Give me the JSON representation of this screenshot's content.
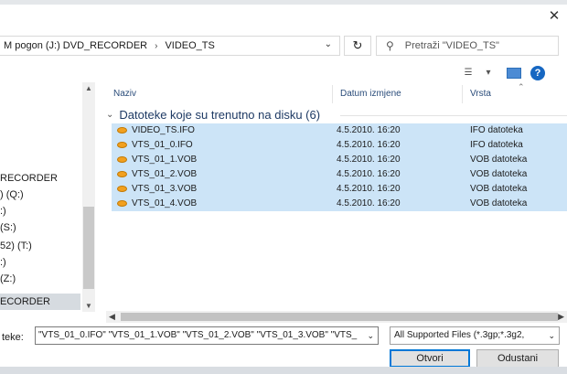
{
  "window": {
    "close_glyph": "✕"
  },
  "address": {
    "drive": "M pogon (J:) DVD_RECORDER",
    "separator": "›",
    "folder": "VIDEO_TS",
    "dropdown_icon": "chevron-down-icon"
  },
  "search": {
    "placeholder": "Pretraži \"VIDEO_TS\""
  },
  "nav": {
    "items": [
      {
        "label": "RECORDER",
        "selected": false
      },
      {
        "label": ") (Q:)",
        "selected": false
      },
      {
        "label": ":)",
        "selected": false
      },
      {
        "label": "(S:)",
        "selected": false
      },
      {
        "label": "52) (T:)",
        "selected": false
      },
      {
        "label": ":)",
        "selected": false
      },
      {
        "label": "(Z:)",
        "selected": false
      },
      {
        "label": "ECORDER",
        "selected": true
      }
    ]
  },
  "columns": {
    "name": "Naziv",
    "date": "Datum izmjene",
    "type": "Vrsta"
  },
  "group": {
    "label": "Datoteke koje su trenutno na disku (6)"
  },
  "files": [
    {
      "name": "VIDEO_TS.IFO",
      "date": "4.5.2010. 16:20",
      "type": "IFO datoteka"
    },
    {
      "name": "VTS_01_0.IFO",
      "date": "4.5.2010. 16:20",
      "type": "IFO datoteka"
    },
    {
      "name": "VTS_01_1.VOB",
      "date": "4.5.2010. 16:20",
      "type": "VOB datoteka"
    },
    {
      "name": "VTS_01_2.VOB",
      "date": "4.5.2010. 16:20",
      "type": "VOB datoteka"
    },
    {
      "name": "VTS_01_3.VOB",
      "date": "4.5.2010. 16:20",
      "type": "VOB datoteka"
    },
    {
      "name": "VTS_01_4.VOB",
      "date": "4.5.2010. 16:20",
      "type": "VOB datoteka"
    }
  ],
  "footer": {
    "filename_label": "teke:",
    "filename_value": "\"VTS_01_0.IFO\" \"VTS_01_1.VOB\" \"VTS_01_2.VOB\" \"VTS_01_3.VOB\" \"VTS_",
    "filter_value": "All Supported Files (*.3gp;*.3g2,",
    "open_label": "Otvori",
    "cancel_label": "Odustani"
  },
  "colors": {
    "selection": "#cce4f7",
    "accent": "#0078d7",
    "file_icon": "#f2a01e"
  }
}
